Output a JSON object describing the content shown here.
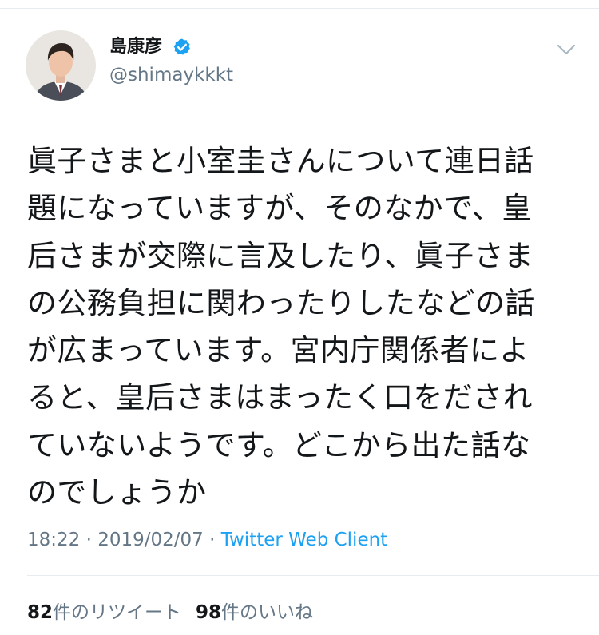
{
  "author": {
    "display_name": "島康彦",
    "handle": "@shimaykkkt",
    "verified": true
  },
  "tweet": {
    "lines": [
      "眞子さまと小室圭さんについて連日話",
      "題になっていますが、そのなかで、皇",
      "后さまが交際に言及したり、眞子さま",
      "の公務負担に関わったりしたなどの話",
      "が広まっています。宮内庁関係者によ",
      "ると、皇后さまはまったく口をだされ",
      "ていないようです。どこから出た話な",
      "のでしょうか"
    ]
  },
  "meta": {
    "time": "18:22",
    "separator": " · ",
    "date": "2019/02/07",
    "source": "Twitter Web Client"
  },
  "stats": {
    "retweets_count": "82",
    "retweets_label": "件のリツイート",
    "likes_count": "98",
    "likes_label": "件のいいね"
  },
  "colors": {
    "text": "#14171a",
    "secondary": "#657786",
    "accent": "#1da1f2",
    "divider": "#e6ecf0"
  }
}
